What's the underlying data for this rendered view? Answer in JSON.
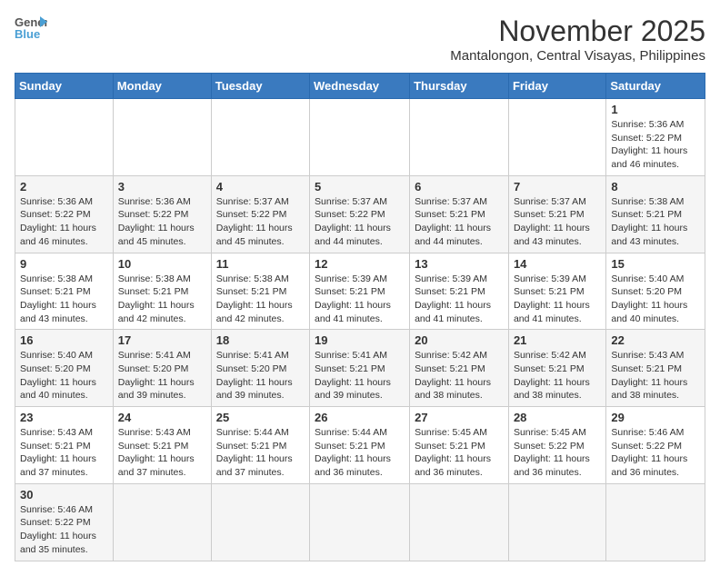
{
  "header": {
    "logo_general": "General",
    "logo_blue": "Blue",
    "month": "November 2025",
    "location": "Mantalongon, Central Visayas, Philippines"
  },
  "weekdays": [
    "Sunday",
    "Monday",
    "Tuesday",
    "Wednesday",
    "Thursday",
    "Friday",
    "Saturday"
  ],
  "weeks": [
    [
      {
        "day": "",
        "info": ""
      },
      {
        "day": "",
        "info": ""
      },
      {
        "day": "",
        "info": ""
      },
      {
        "day": "",
        "info": ""
      },
      {
        "day": "",
        "info": ""
      },
      {
        "day": "",
        "info": ""
      },
      {
        "day": "1",
        "info": "Sunrise: 5:36 AM\nSunset: 5:22 PM\nDaylight: 11 hours and 46 minutes."
      }
    ],
    [
      {
        "day": "2",
        "info": "Sunrise: 5:36 AM\nSunset: 5:22 PM\nDaylight: 11 hours and 46 minutes."
      },
      {
        "day": "3",
        "info": "Sunrise: 5:36 AM\nSunset: 5:22 PM\nDaylight: 11 hours and 45 minutes."
      },
      {
        "day": "4",
        "info": "Sunrise: 5:37 AM\nSunset: 5:22 PM\nDaylight: 11 hours and 45 minutes."
      },
      {
        "day": "5",
        "info": "Sunrise: 5:37 AM\nSunset: 5:22 PM\nDaylight: 11 hours and 44 minutes."
      },
      {
        "day": "6",
        "info": "Sunrise: 5:37 AM\nSunset: 5:21 PM\nDaylight: 11 hours and 44 minutes."
      },
      {
        "day": "7",
        "info": "Sunrise: 5:37 AM\nSunset: 5:21 PM\nDaylight: 11 hours and 43 minutes."
      },
      {
        "day": "8",
        "info": "Sunrise: 5:38 AM\nSunset: 5:21 PM\nDaylight: 11 hours and 43 minutes."
      }
    ],
    [
      {
        "day": "9",
        "info": "Sunrise: 5:38 AM\nSunset: 5:21 PM\nDaylight: 11 hours and 43 minutes."
      },
      {
        "day": "10",
        "info": "Sunrise: 5:38 AM\nSunset: 5:21 PM\nDaylight: 11 hours and 42 minutes."
      },
      {
        "day": "11",
        "info": "Sunrise: 5:38 AM\nSunset: 5:21 PM\nDaylight: 11 hours and 42 minutes."
      },
      {
        "day": "12",
        "info": "Sunrise: 5:39 AM\nSunset: 5:21 PM\nDaylight: 11 hours and 41 minutes."
      },
      {
        "day": "13",
        "info": "Sunrise: 5:39 AM\nSunset: 5:21 PM\nDaylight: 11 hours and 41 minutes."
      },
      {
        "day": "14",
        "info": "Sunrise: 5:39 AM\nSunset: 5:21 PM\nDaylight: 11 hours and 41 minutes."
      },
      {
        "day": "15",
        "info": "Sunrise: 5:40 AM\nSunset: 5:20 PM\nDaylight: 11 hours and 40 minutes."
      }
    ],
    [
      {
        "day": "16",
        "info": "Sunrise: 5:40 AM\nSunset: 5:20 PM\nDaylight: 11 hours and 40 minutes."
      },
      {
        "day": "17",
        "info": "Sunrise: 5:41 AM\nSunset: 5:20 PM\nDaylight: 11 hours and 39 minutes."
      },
      {
        "day": "18",
        "info": "Sunrise: 5:41 AM\nSunset: 5:20 PM\nDaylight: 11 hours and 39 minutes."
      },
      {
        "day": "19",
        "info": "Sunrise: 5:41 AM\nSunset: 5:21 PM\nDaylight: 11 hours and 39 minutes."
      },
      {
        "day": "20",
        "info": "Sunrise: 5:42 AM\nSunset: 5:21 PM\nDaylight: 11 hours and 38 minutes."
      },
      {
        "day": "21",
        "info": "Sunrise: 5:42 AM\nSunset: 5:21 PM\nDaylight: 11 hours and 38 minutes."
      },
      {
        "day": "22",
        "info": "Sunrise: 5:43 AM\nSunset: 5:21 PM\nDaylight: 11 hours and 38 minutes."
      }
    ],
    [
      {
        "day": "23",
        "info": "Sunrise: 5:43 AM\nSunset: 5:21 PM\nDaylight: 11 hours and 37 minutes."
      },
      {
        "day": "24",
        "info": "Sunrise: 5:43 AM\nSunset: 5:21 PM\nDaylight: 11 hours and 37 minutes."
      },
      {
        "day": "25",
        "info": "Sunrise: 5:44 AM\nSunset: 5:21 PM\nDaylight: 11 hours and 37 minutes."
      },
      {
        "day": "26",
        "info": "Sunrise: 5:44 AM\nSunset: 5:21 PM\nDaylight: 11 hours and 36 minutes."
      },
      {
        "day": "27",
        "info": "Sunrise: 5:45 AM\nSunset: 5:21 PM\nDaylight: 11 hours and 36 minutes."
      },
      {
        "day": "28",
        "info": "Sunrise: 5:45 AM\nSunset: 5:22 PM\nDaylight: 11 hours and 36 minutes."
      },
      {
        "day": "29",
        "info": "Sunrise: 5:46 AM\nSunset: 5:22 PM\nDaylight: 11 hours and 36 minutes."
      }
    ],
    [
      {
        "day": "30",
        "info": "Sunrise: 5:46 AM\nSunset: 5:22 PM\nDaylight: 11 hours and 35 minutes."
      },
      {
        "day": "",
        "info": ""
      },
      {
        "day": "",
        "info": ""
      },
      {
        "day": "",
        "info": ""
      },
      {
        "day": "",
        "info": ""
      },
      {
        "day": "",
        "info": ""
      },
      {
        "day": "",
        "info": ""
      }
    ]
  ]
}
